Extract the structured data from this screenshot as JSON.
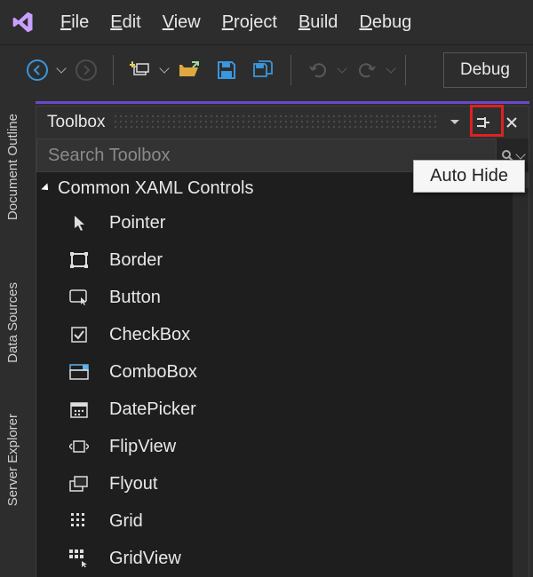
{
  "menubar": {
    "file": "File",
    "edit": "Edit",
    "view": "View",
    "project": "Project",
    "build": "Build",
    "debug": "Debug"
  },
  "toolbar": {
    "debug_target": "Debug"
  },
  "side_tabs": {
    "document_outline": "Document Outline",
    "data_sources": "Data Sources",
    "server_explorer": "Server Explorer"
  },
  "toolbox": {
    "title": "Toolbox",
    "search_placeholder": "Search Toolbox",
    "tooltip": "Auto Hide",
    "category": "Common XAML Controls",
    "items": {
      "pointer": "Pointer",
      "border": "Border",
      "button": "Button",
      "checkbox": "CheckBox",
      "combobox": "ComboBox",
      "datepicker": "DatePicker",
      "flipview": "FlipView",
      "flyout": "Flyout",
      "grid": "Grid",
      "gridview": "GridView"
    }
  }
}
